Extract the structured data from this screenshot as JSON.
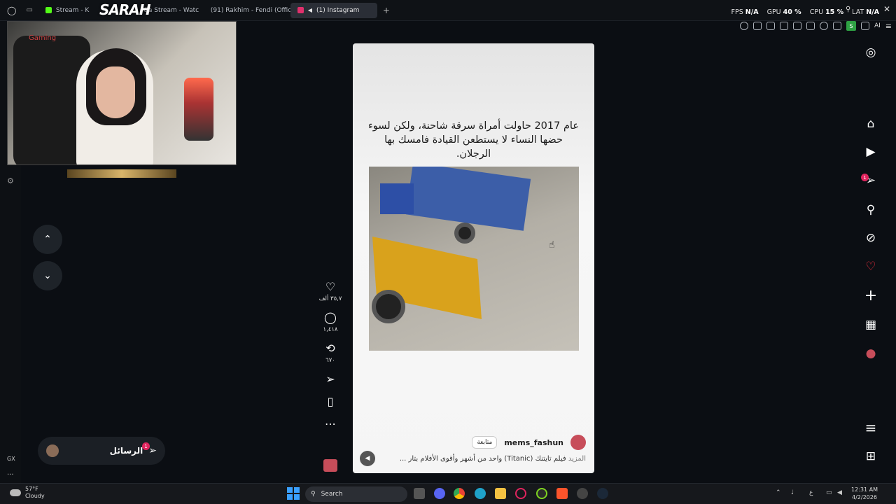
{
  "tabs": [
    {
      "label": "Stream - K",
      "color": "#53fc18"
    },
    {
      "label": "Ga Stream - Watc",
      "color": "#9146ff"
    },
    {
      "label": "(91) Rakhim - Fendi (Offici",
      "color": "#ff0000"
    },
    {
      "label": "(1) Instagram",
      "color": "#e1306c",
      "active": true
    }
  ],
  "hud": {
    "fps_label": "FPS",
    "fps": "N/A",
    "gpu_label": "GPU",
    "gpu": "40 %",
    "cpu_label": "CPU",
    "cpu": "15 %",
    "lat_label": "LAT",
    "lat": "N/A"
  },
  "toolbar": {
    "s_badge": "S",
    "ai_label": "AI"
  },
  "stream": {
    "logo": "SARAH",
    "watermark": "Gaming"
  },
  "nav": {
    "up": "⌃",
    "down": "⌄"
  },
  "messages": {
    "label": "الرسائل",
    "badge": "1"
  },
  "sidebar_small": {
    "gx": "GX",
    "more": "..."
  },
  "reel": {
    "caption": "عام 2017 حاولت أمراة سرقة شاحنة، ولكن لسوء حضها النساء لا يستطعن القيادة فامسك بها الرجلان.",
    "username": "mems_fashun",
    "follow": "متابعة",
    "description": "فيلم تايتنك (Titanic) واحد من أشهر وأقوى الأفلام بتار ...",
    "more": "المزيد"
  },
  "actions": [
    {
      "icon": "heart-icon",
      "glyph": "♡",
      "count": "٣٥,٧ ألف"
    },
    {
      "icon": "comment-icon",
      "glyph": "◯",
      "count": "١,٤١٨"
    },
    {
      "icon": "repost-icon",
      "glyph": "⟲",
      "count": "٦٧٠"
    },
    {
      "icon": "share-icon",
      "glyph": "➢",
      "count": ""
    },
    {
      "icon": "save-icon",
      "glyph": "▯",
      "count": ""
    },
    {
      "icon": "more-icon",
      "glyph": "⋯",
      "count": ""
    }
  ],
  "right_nav": [
    {
      "name": "instagram-icon",
      "glyph": "◎"
    },
    {
      "name": "home-icon",
      "glyph": "⌂"
    },
    {
      "name": "reels-icon",
      "glyph": "▶"
    },
    {
      "name": "messages-icon",
      "glyph": "➢",
      "badge": "1"
    },
    {
      "name": "search-icon",
      "glyph": "⚲"
    },
    {
      "name": "explore-icon",
      "glyph": "⊘"
    },
    {
      "name": "notifications-icon",
      "glyph": "♡"
    },
    {
      "name": "create-icon",
      "glyph": "+"
    },
    {
      "name": "dashboard-icon",
      "glyph": "▦"
    },
    {
      "name": "profile-avatar",
      "glyph": "●"
    },
    {
      "name": "menu-icon",
      "glyph": "≡"
    },
    {
      "name": "also-from-meta-icon",
      "glyph": "⊞"
    }
  ],
  "taskbar": {
    "temp": "57°F",
    "condition": "Cloudy",
    "search": "Search",
    "time": "12:31 AM",
    "date": "4/2/2026",
    "lang": "ع"
  }
}
